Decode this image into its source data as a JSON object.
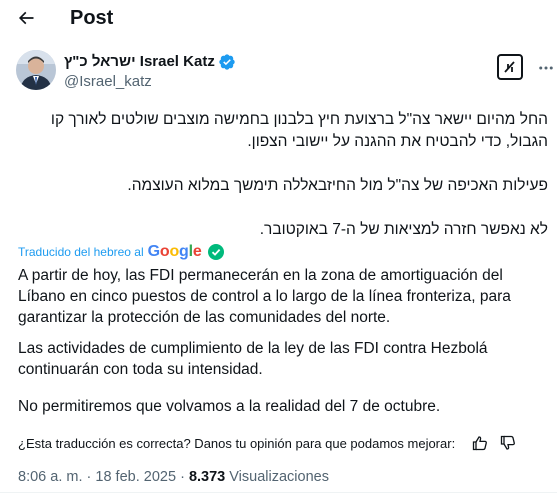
{
  "topbar": {
    "title": "Post"
  },
  "author": {
    "name": "ישראל כ\"ץ Israel Katz",
    "handle": "@Israel_katz"
  },
  "post": {
    "hebrew_paragraphs": [
      "החל מהיום יישאר צה\"ל ברצועת חיץ בלבנון בחמישה מוצבים שולטים לאורך קו הגבול, כדי להבטיח את ההגנה על יישובי הצפון.",
      "פעילות האכיפה של צה\"ל מול החיזבאללה תימשך במלוא העוצמה.",
      "לא נאפשר חזרה למציאות של ה-7 באוקטובר."
    ],
    "translation_label": "Traducido del hebreo al",
    "translation_provider": "Google",
    "spanish_paragraphs": [
      "A partir de hoy, las FDI permanecerán en la zona de amortiguación del Líbano en cinco puestos de control a lo largo de la línea fronteriza, para garantizar la protección de las comunidades del norte.",
      "Las actividades de cumplimiento de la ley de las FDI contra Hezbolá continuarán con toda su intensidad.",
      "No permitiremos que volvamos a la realidad del 7 de octubre."
    ],
    "feedback_question": "¿Esta traducción es correcta? Danos tu opinión para que podamos mejorar:",
    "time": "8:06 a. m.",
    "date": "18 feb. 2025",
    "views_count": "8.373",
    "views_label": "Visualizaciones",
    "separator": "·"
  },
  "colors": {
    "text": "#0f1419",
    "secondary": "#536471",
    "accent": "#1d9bf0",
    "verified": "#1d9bf0",
    "check_green": "#00ba7c"
  },
  "icons": {
    "back": "arrow-left-icon",
    "verified": "verified-badge-icon",
    "grok": "grok-icon",
    "more": "more-icon",
    "check": "check-circle-icon",
    "thumbs_up": "thumbs-up-icon",
    "thumbs_down": "thumbs-down-icon"
  }
}
